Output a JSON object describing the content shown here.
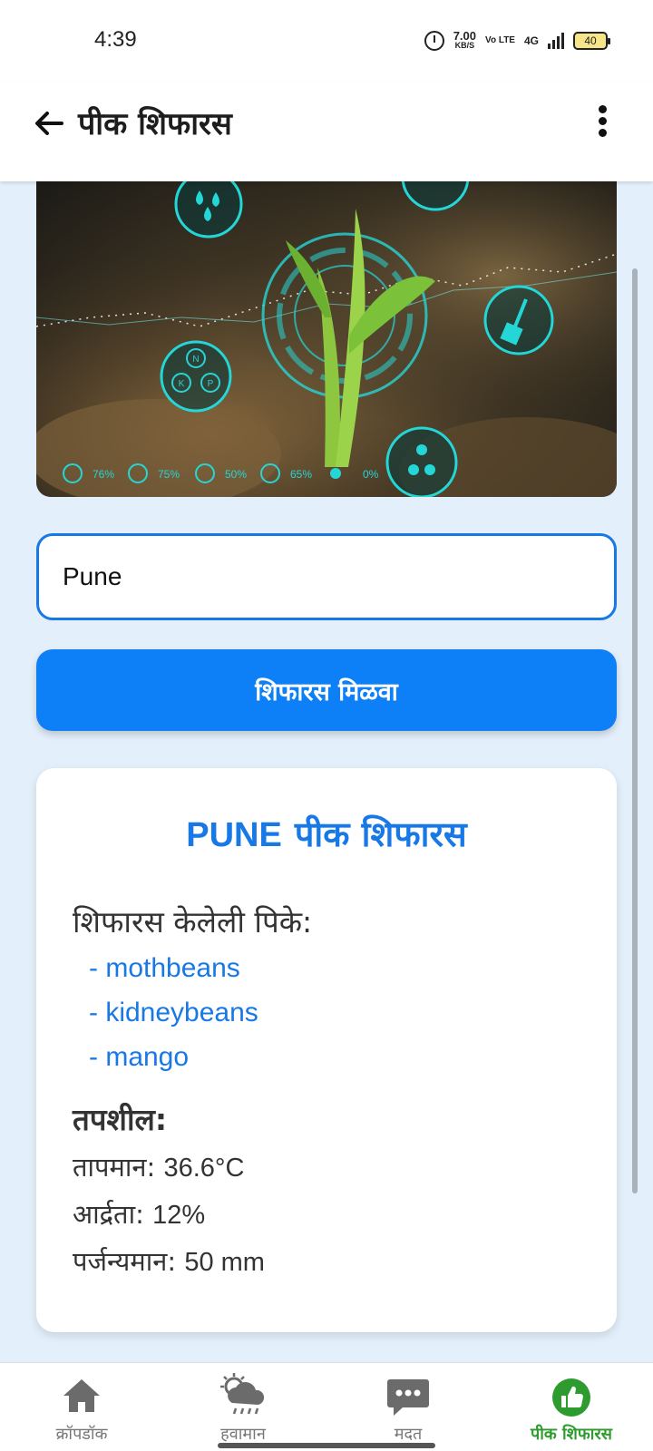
{
  "status_bar": {
    "time": "4:39",
    "speed_value": "7.00",
    "speed_unit": "KB/S",
    "volte": "Vo LTE",
    "network": "4G",
    "battery": "40"
  },
  "app_bar": {
    "title": "पीक शिफारस"
  },
  "form": {
    "city_value": "Pune",
    "submit_label": "शिफारस मिळवा"
  },
  "result": {
    "city": "PUNE",
    "title_suffix": "पीक शिफारस",
    "crops_heading": "शिफारस केलेली पिके:",
    "crops": [
      "- mothbeans",
      "- kidneybeans",
      "- mango"
    ],
    "details_heading": "तपशील:",
    "details": [
      {
        "label": "तापमान:",
        "value": "36.6°C"
      },
      {
        "label": "आर्द्रता:",
        "value": "12%"
      },
      {
        "label": "पर्जन्यमान:",
        "value": "50 mm"
      }
    ]
  },
  "hero_overlay": {
    "stats": [
      "76%",
      "75%",
      "50%",
      "65%",
      "0%"
    ],
    "nutrients": [
      "N",
      "K",
      "P"
    ]
  },
  "bottom_nav": [
    {
      "label": "क्रॉपडॉक",
      "icon": "home-icon"
    },
    {
      "label": "हवामान",
      "icon": "weather-icon"
    },
    {
      "label": "मदत",
      "icon": "chat-icon"
    },
    {
      "label": "पीक शिफारस",
      "icon": "thumbs-up-icon",
      "active": true
    }
  ],
  "colors": {
    "accent": "#1778e6",
    "button": "#0d7ff7",
    "active_nav": "#2e9b2e",
    "background": "#e3effa"
  }
}
